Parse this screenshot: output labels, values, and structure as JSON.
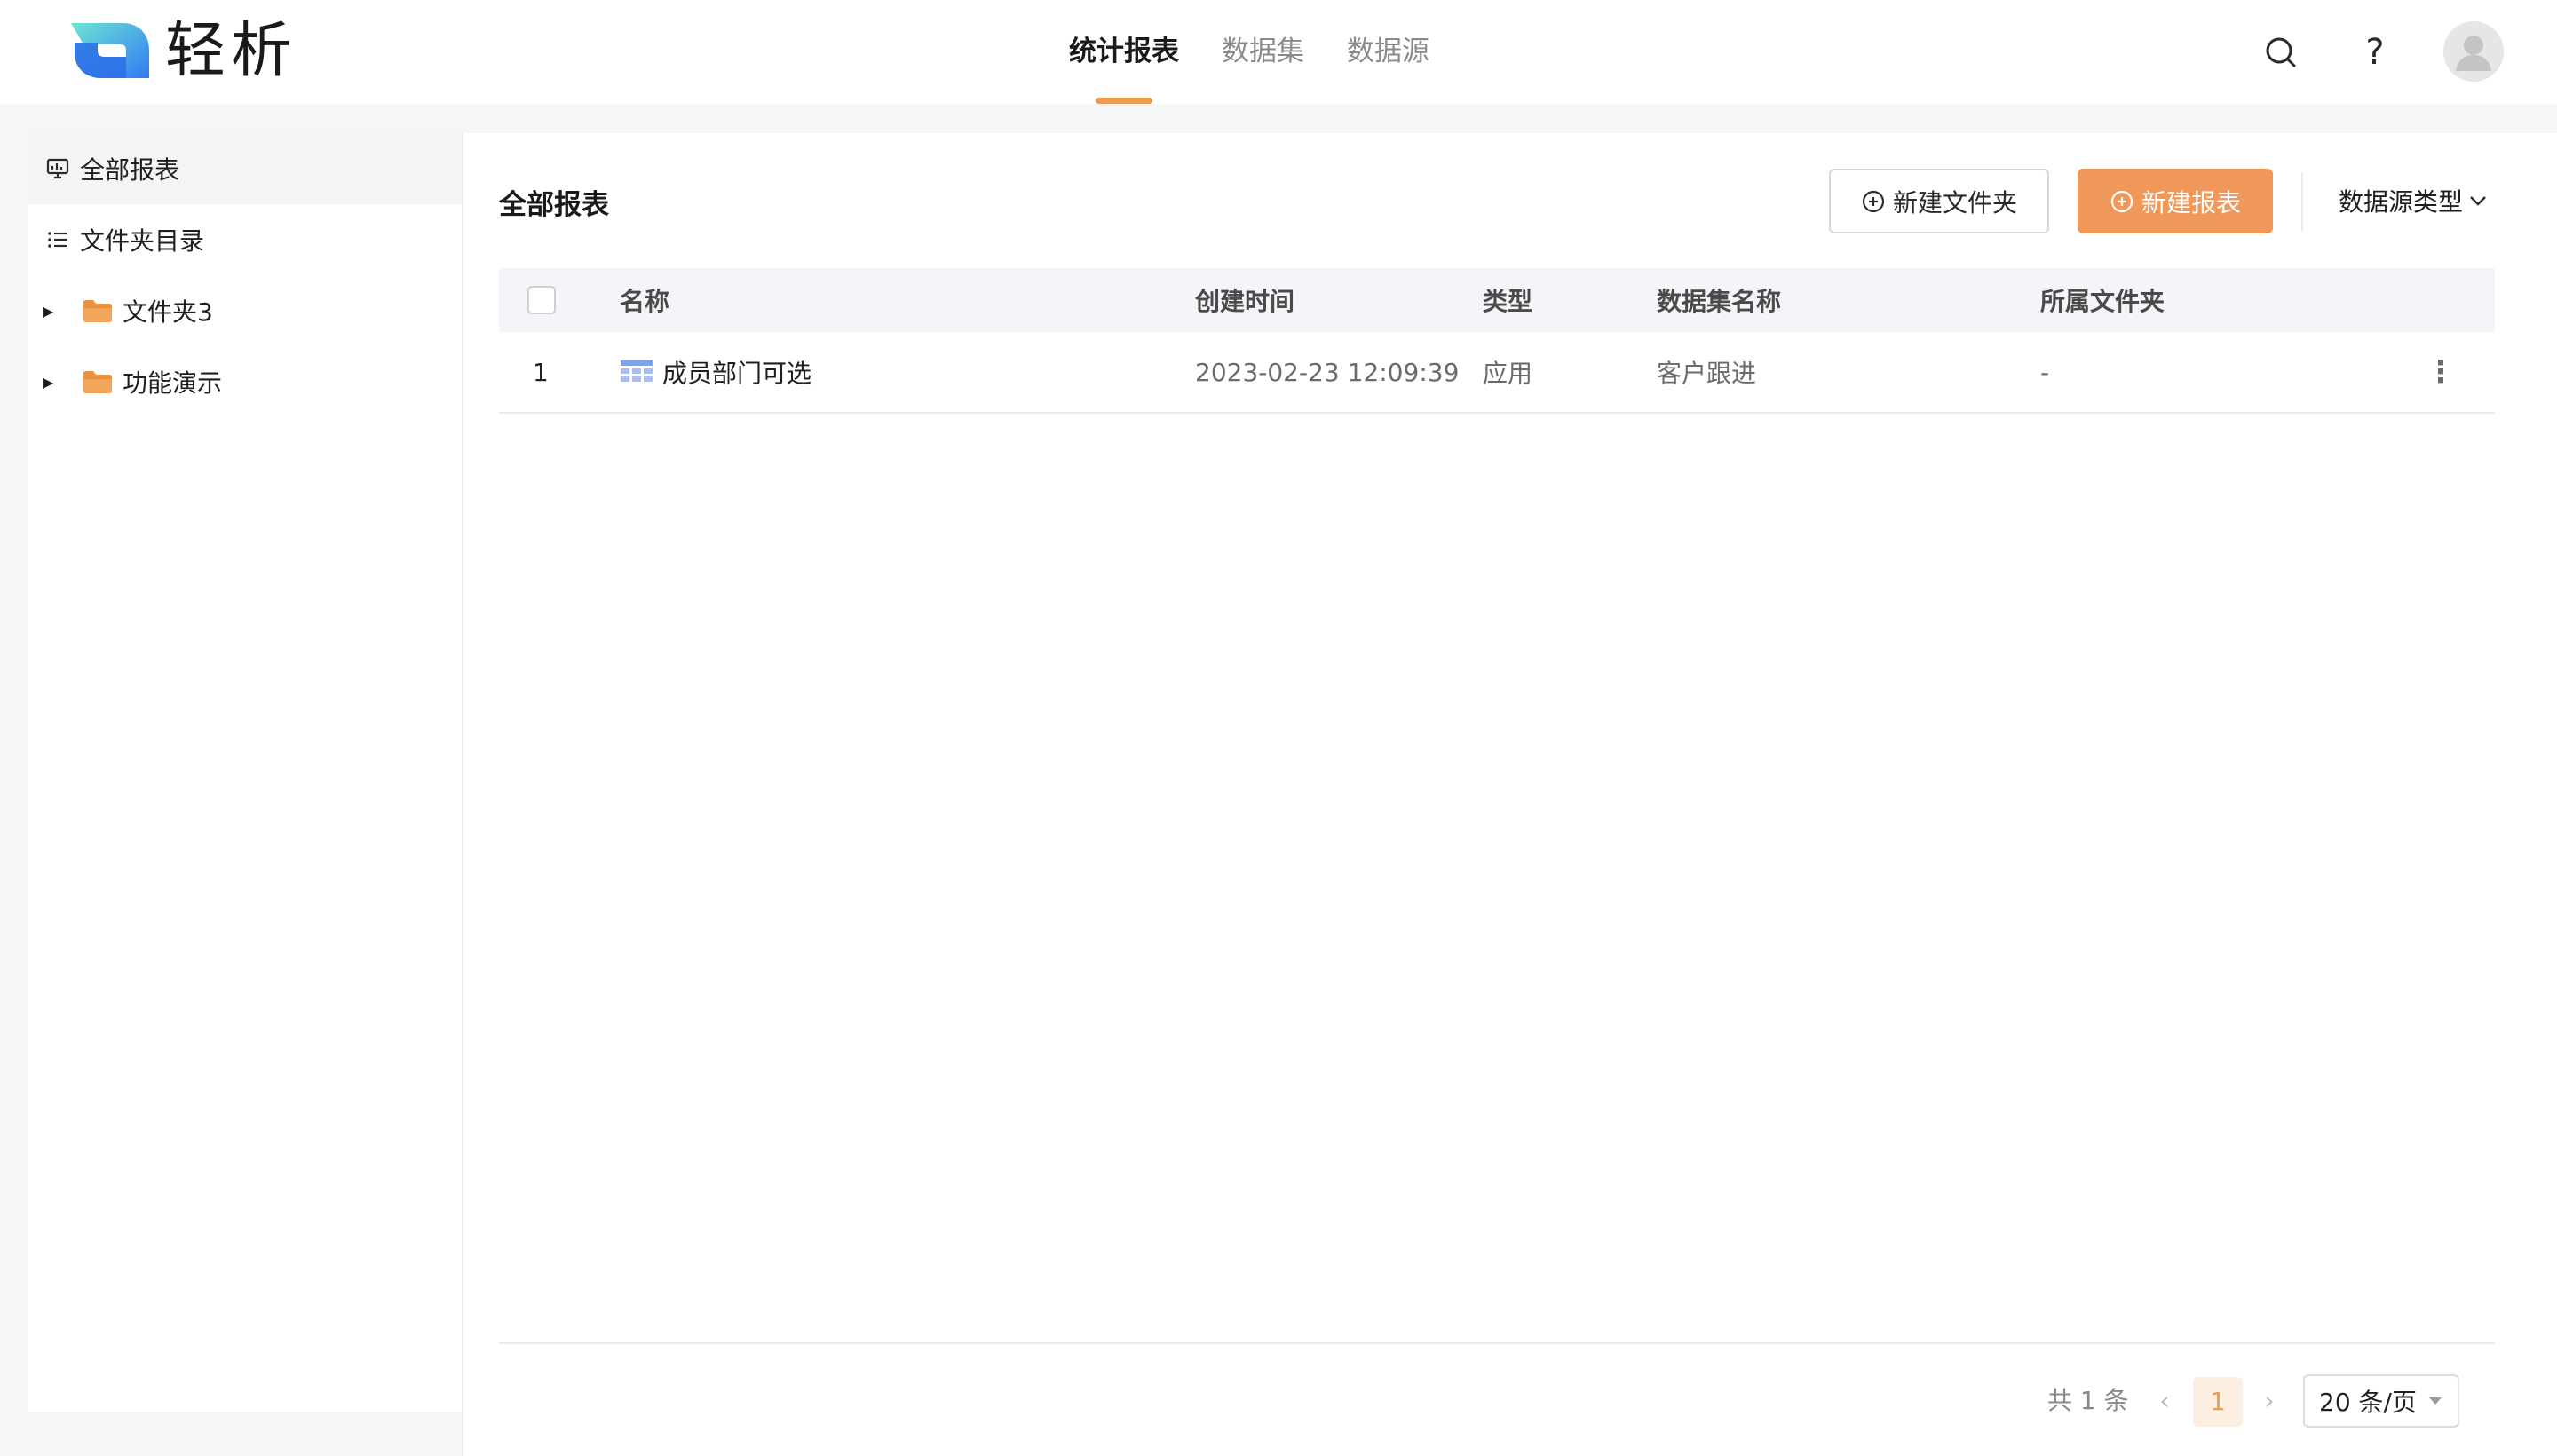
{
  "app": {
    "name": "轻析"
  },
  "nav": {
    "tabs": [
      {
        "label": "统计报表",
        "active": true
      },
      {
        "label": "数据集",
        "active": false
      },
      {
        "label": "数据源",
        "active": false
      }
    ]
  },
  "header": {
    "help_label": "?"
  },
  "sidebar": {
    "all_reports": "全部报表",
    "folder_directory": "文件夹目录",
    "folders": [
      {
        "label": "文件夹3"
      },
      {
        "label": "功能演示"
      }
    ]
  },
  "main": {
    "title": "全部报表",
    "new_folder_label": "新建文件夹",
    "new_report_label": "新建报表",
    "filter_label": "数据源类型"
  },
  "table": {
    "columns": {
      "name": "名称",
      "created": "创建时间",
      "type": "类型",
      "dataset": "数据集名称",
      "folder": "所属文件夹"
    },
    "rows": [
      {
        "index": "1",
        "name": "成员部门可选",
        "created": "2023-02-23 12:09:39",
        "type": "应用",
        "dataset": "客户跟进",
        "folder": "-",
        "more": "⋮"
      }
    ]
  },
  "pagination": {
    "total_label": "共 1 条",
    "prev": "‹",
    "next": "›",
    "current_page": "1",
    "page_size_label": "20 条/页"
  },
  "colors": {
    "accent": "#ef9a4e",
    "primary_button": "#f0985a",
    "header_bg": "#f3f5f9",
    "sidebar_active_bg": "#f3f4f6"
  }
}
